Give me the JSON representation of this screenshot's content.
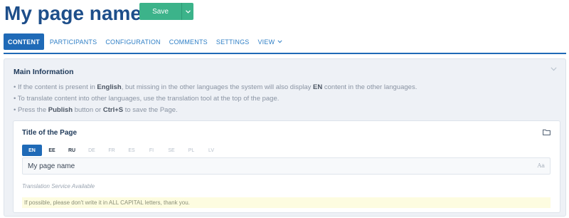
{
  "header": {
    "title": "My page name",
    "save_label": "Save",
    "save_caret_icon": "chevron-down-icon"
  },
  "tabs": [
    {
      "label": "CONTENT",
      "active": true
    },
    {
      "label": "PARTICIPANTS",
      "active": false
    },
    {
      "label": "CONFIGURATION",
      "active": false
    },
    {
      "label": "COMMENTS",
      "active": false
    },
    {
      "label": "SETTINGS",
      "active": false
    },
    {
      "label": "VIEW",
      "active": false,
      "has_dropdown": true
    }
  ],
  "main_info": {
    "title": "Main Information",
    "lines": [
      {
        "t1": "If the content is present in ",
        "b1": "English",
        "t2": ", but missing in the other languages the system will also display ",
        "b2": "EN",
        "t3": " content in the other languages."
      },
      {
        "t1": "To translate content into other languages, use the translation tool at the top of the page."
      },
      {
        "t1": "Press the ",
        "b1": "Publish",
        "t2": " button or ",
        "b2": "Ctrl+S",
        "t3": " to save the Page."
      }
    ]
  },
  "title_card": {
    "title": "Title of the Page",
    "folder_icon": "folder-icon",
    "languages": [
      {
        "code": "EN",
        "state": "active"
      },
      {
        "code": "EE",
        "state": "filled"
      },
      {
        "code": "RU",
        "state": "filled"
      },
      {
        "code": "DE",
        "state": "empty"
      },
      {
        "code": "FR",
        "state": "empty"
      },
      {
        "code": "ES",
        "state": "empty"
      },
      {
        "code": "FI",
        "state": "empty"
      },
      {
        "code": "SE",
        "state": "empty"
      },
      {
        "code": "PL",
        "state": "empty"
      },
      {
        "code": "LV",
        "state": "empty"
      }
    ],
    "input_value": "My page name",
    "input_icon": "Aa",
    "translation_note": "Translation Service Available",
    "hint": "If possible, please don't write it in ALL CAPITAL letters, thank you."
  },
  "colors": {
    "accent": "#1f6ab7",
    "save": "#3cb38a",
    "title": "#1d4e8a"
  }
}
